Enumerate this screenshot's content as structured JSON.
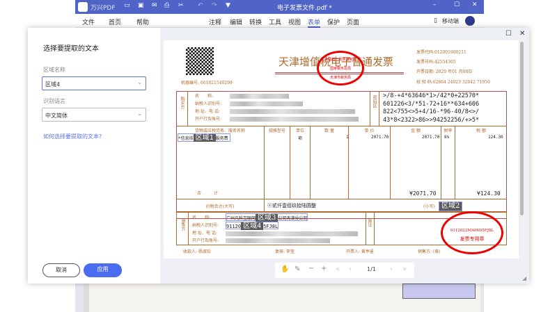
{
  "app": {
    "name": "万兴PDF",
    "file_title": "电子发票文件.pdf *"
  },
  "menu": {
    "left": [
      "文件",
      "首页",
      "帮助"
    ],
    "center": [
      "注释",
      "编辑",
      "转换",
      "工具",
      "视图",
      "表单",
      "保护",
      "页面"
    ],
    "active": "表单",
    "mobile": "移动端"
  },
  "panel": {
    "title": "选择要提取的文本",
    "region_label": "区域名称",
    "region_value": "区域4",
    "lang_label": "识别语言",
    "lang_value": "中文简体",
    "help_link": "如何选择要提取的文本?",
    "cancel": "取消",
    "apply": "应用"
  },
  "invoice": {
    "title": "天津增值税电子普通发票",
    "machine_no": "机器编号: 661821540299",
    "code": "发票代码:012001900211",
    "number": "发票号码:42554305",
    "date": "开票日期: 2020 年01 月08日",
    "check": "校 验 码:62864 24023 32042 71950",
    "buyer_side": "购买方",
    "buyer_fields": [
      "名　　称:",
      "纳税人识别号:",
      "地 址、电 话:",
      "开户行及账号:"
    ],
    "cipher_label": "密码区",
    "cipher": [
      ">/8-+4*63646*1>/42*0+22570*",
      "601226<3/*51-72+16**634+606",
      "822<755<>5+4/16-*96-40/8<>/",
      "43*8<2322>86>>94252256/+>5*"
    ],
    "headers": [
      "货物或应税劳务、服务名称",
      "规格型号",
      "单位",
      "数 量",
      "单 价",
      "金 额",
      "税率",
      "税 额"
    ],
    "row": {
      "name_a": "*信息技",
      "name_b": "服务费",
      "unit": "项",
      "qty": "1",
      "price": "2071.70",
      "amount": "2071.70",
      "rate": "6%",
      "tax": "124.30"
    },
    "total_label": "合　　　计",
    "total_amount": "¥2071.70",
    "total_tax": "¥124.30",
    "sum_label": "价税合计(大写)",
    "sum_words": "ⓧ贰仟壹佰玖拾陆圆整",
    "small_label": "(小写)",
    "seller_side": "销售方",
    "seller_fields": [
      "名　　称:",
      "纳税人识别号:",
      "地 址、电 话:",
      "开户行及账号:"
    ],
    "seller_name_a": "广州凡科互联网",
    "seller_name_b": "公司天津分公司",
    "seller_tax_a": "91120",
    "seller_tax_b": "5FJ8L",
    "remark": "备注",
    "payee": "收款人: 杨淑珍",
    "reviewer": "复核: 李莹",
    "issuer": "开票人: 黄亭曼",
    "seller_sign": "销售方: (章)",
    "stamp1": "全国统一发票监制章",
    "stamp1_b": "国家税务总局",
    "stamp1_c": "天津市税务局",
    "stamp2": "9112022MA06D5FJ8L",
    "stamp2_b": "发票专用章"
  },
  "regions": [
    "区域1",
    "区域2",
    "区域3",
    "区域4"
  ],
  "toolbar": {
    "page": "1/1"
  }
}
